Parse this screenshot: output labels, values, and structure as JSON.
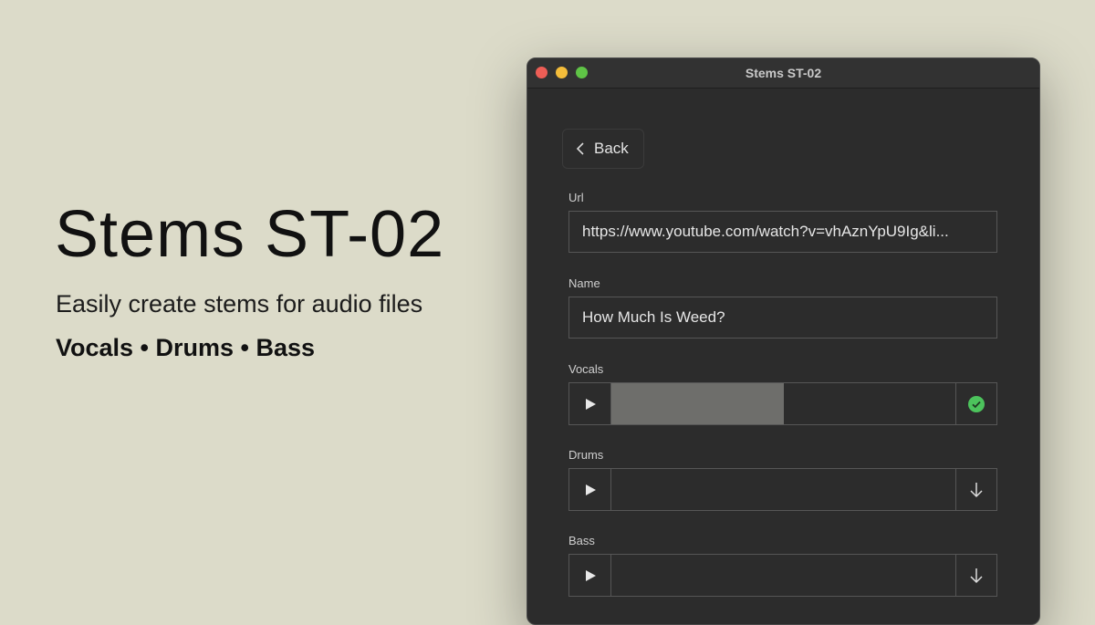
{
  "hero": {
    "title": "Stems ST-02",
    "subtitle": "Easily create stems for audio files",
    "tags": "Vocals • Drums • Bass"
  },
  "window": {
    "title": "Stems ST-02"
  },
  "back": {
    "label": "Back"
  },
  "url": {
    "label": "Url",
    "value": "https://www.youtube.com/watch?v=vhAznYpU9Ig&li..."
  },
  "name": {
    "label": "Name",
    "value": "How Much Is Weed?"
  },
  "stems": [
    {
      "label": "Vocals",
      "progress": 0.5,
      "status": "done",
      "status_icon": "check-circle-icon"
    },
    {
      "label": "Drums",
      "progress": 0,
      "status": "download",
      "status_icon": "download-arrow-icon"
    },
    {
      "label": "Bass",
      "progress": 0,
      "status": "download",
      "status_icon": "download-arrow-icon"
    }
  ],
  "colors": {
    "background": "#dcdbc9",
    "window": "#2c2c2c",
    "success": "#4cc35c",
    "progress": "#6e6e6b"
  }
}
